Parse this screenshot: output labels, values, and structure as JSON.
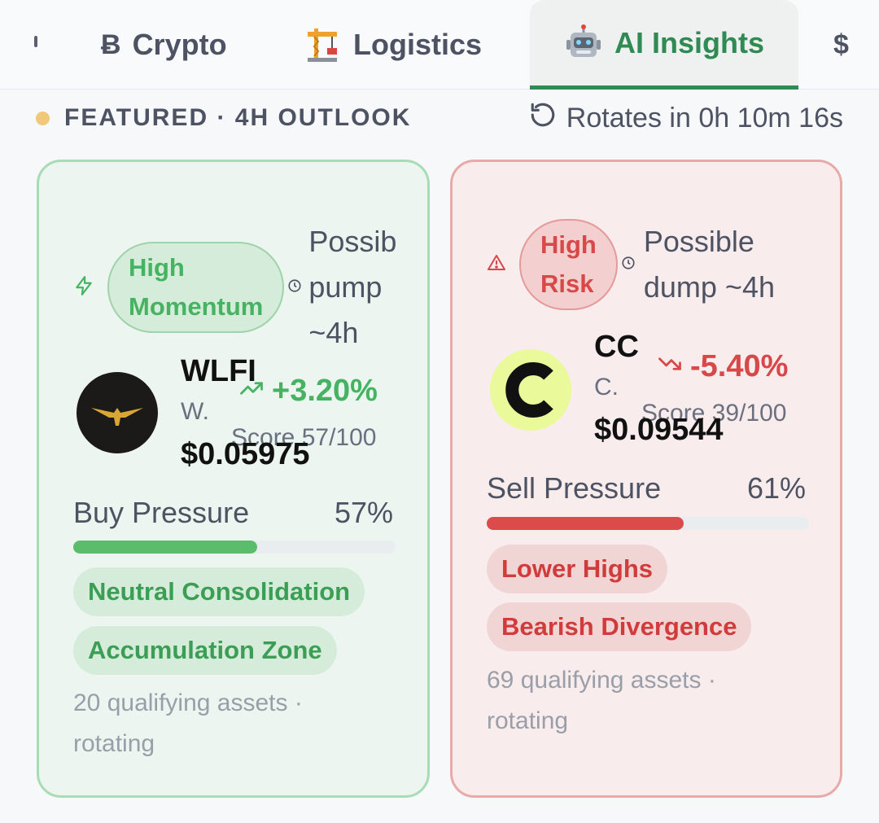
{
  "tabs": [
    {
      "label": "Crypto",
      "icon": "bitcoin-icon",
      "glyph": "Ƀ"
    },
    {
      "label": "Logistics",
      "icon": "crane-icon"
    },
    {
      "label": "AI Insights",
      "icon": "robot-icon",
      "active": true
    },
    {
      "label": "",
      "icon": "dollar-icon",
      "glyph": "$"
    }
  ],
  "header": {
    "featured_label": "FEATURED · 4H OUTLOOK",
    "rotates_label": "Rotates in 0h 10m 16s"
  },
  "cards": [
    {
      "theme": "green",
      "badge": "High Momentum",
      "badge_lines": [
        "High",
        "Momentum"
      ],
      "badge_icon": "lightning-icon",
      "outlook_icon": "clock-icon",
      "outlook_lines": [
        "Possib",
        "pump",
        "~4h"
      ],
      "symbol": "WLFI",
      "name": "W.",
      "price": "$0.05975",
      "change": "+3.20%",
      "change_icon": "trending-up-icon",
      "score": "Score 57/100",
      "pressure_label": "Buy Pressure",
      "pressure_pct": "57%",
      "pressure_value": 0.57,
      "tags": [
        "Neutral Consolidation",
        "Accumulation Zone"
      ],
      "footnote_lines": [
        "20 qualifying assets ·",
        "rotating"
      ]
    },
    {
      "theme": "red",
      "badge": "High Risk",
      "badge_lines": [
        "High",
        "Risk"
      ],
      "badge_icon": "warning-icon",
      "outlook_icon": "clock-icon",
      "outlook_lines": [
        "Possible",
        "dump ~4h"
      ],
      "symbol": "CC",
      "name": "C.",
      "price": "$0.09544",
      "change": "-5.40%",
      "change_icon": "trending-down-icon",
      "score": "Score 39/100",
      "pressure_label": "Sell Pressure",
      "pressure_pct": "61%",
      "pressure_value": 0.61,
      "tags": [
        "Lower Highs",
        "Bearish Divergence"
      ],
      "footnote_lines": [
        "69 qualifying assets ·",
        "rotating"
      ]
    }
  ],
  "colors": {
    "accent_green": "#2f8a53",
    "momentum_green": "#46b362",
    "risk_red": "#d94848",
    "featured_dot": "#f1c77a"
  }
}
